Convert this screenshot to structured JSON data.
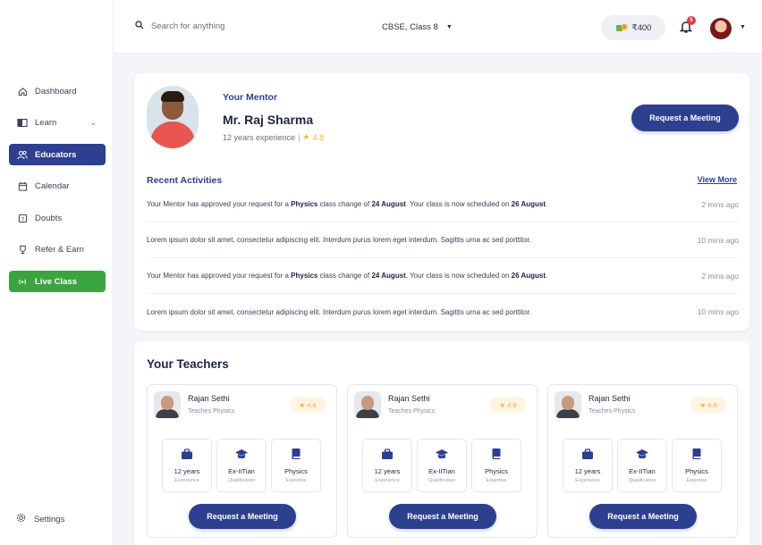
{
  "search": {
    "placeholder": "Search for anything"
  },
  "header": {
    "class_selector": "CBSE, Class 8",
    "coins": "₹400",
    "notification_count": "5"
  },
  "sidebar": {
    "items": [
      {
        "label": "Dashboard",
        "icon": "home-icon"
      },
      {
        "label": "Learn",
        "icon": "book-icon"
      },
      {
        "label": "Educators",
        "icon": "users-icon"
      },
      {
        "label": "Calendar",
        "icon": "calendar-icon"
      },
      {
        "label": "Doubts",
        "icon": "question-icon"
      },
      {
        "label": "Refer & Earn",
        "icon": "trophy-icon"
      },
      {
        "label": "Live Class",
        "icon": "broadcast-icon"
      }
    ],
    "settings": "Settings"
  },
  "mentor": {
    "label": "Your Mentor",
    "name": "Mr. Raj Sharma",
    "experience": "12 years experience",
    "rating": "4.8",
    "button": "Request a Meeting"
  },
  "activities": {
    "title": "Recent Activities",
    "view_more": "View More",
    "rows": [
      {
        "pre": "Your Mentor has approved your request for a ",
        "b1": "Physics",
        "mid": " class change of ",
        "b2": "24 August",
        "mid2": ". Your class is now scheduled on ",
        "b3": "26 August",
        "post": ".",
        "time": "2 mins ago"
      },
      {
        "pre": "Lorem ipsum dolor sit amet, consectetur adipiscing elit. Interdum purus lorem eget interdum. Sagittis urna ac sed porttitor.",
        "b1": "",
        "mid": "",
        "b2": "",
        "mid2": "",
        "b3": "",
        "post": "",
        "time": "10 mins ago"
      },
      {
        "pre": "Your Mentor has approved your request for a ",
        "b1": "Physics",
        "mid": " class change of ",
        "b2": "24 August",
        "mid2": ". Your class is now scheduled on ",
        "b3": "26 August",
        "post": ".",
        "time": "2 mins ago"
      },
      {
        "pre": "Lorem ipsum dolor sit amet, consectetur adipiscing elit. Interdum purus lorem eget interdum. Sagittis urna ac sed porttitor.",
        "b1": "",
        "mid": "",
        "b2": "",
        "mid2": "",
        "b3": "",
        "post": "",
        "time": "10 mins ago"
      }
    ]
  },
  "teachers": {
    "title": "Your Teachers",
    "list": [
      {
        "name": "Rajan Sethi",
        "subject": "Teaches Physics",
        "rating": "4.8",
        "experience": "12 years",
        "experience_label": "Experience",
        "qualification": "Ex-IITian",
        "qualification_label": "Qualification",
        "expertise": "Physics",
        "expertise_label": "Expertise",
        "button": "Request a Meeting"
      },
      {
        "name": "Rajan Sethi",
        "subject": "Teaches Physics",
        "rating": "4.8",
        "experience": "12 years",
        "experience_label": "Experience",
        "qualification": "Ex-IITian",
        "qualification_label": "Qualification",
        "expertise": "Physics",
        "expertise_label": "Expertise",
        "button": "Request a Meeting"
      },
      {
        "name": "Rajan Sethi",
        "subject": "Teaches Physics",
        "rating": "4.8",
        "experience": "12 years",
        "experience_label": "Experience",
        "qualification": "Ex-IITian",
        "qualification_label": "Qualification",
        "expertise": "Physics",
        "expertise_label": "Expertise",
        "button": "Request a Meeting"
      }
    ]
  },
  "colors": {
    "primary": "#2d3f8f",
    "live": "#3aa53f",
    "star": "#f2b431",
    "badge": "#e23b3b"
  }
}
